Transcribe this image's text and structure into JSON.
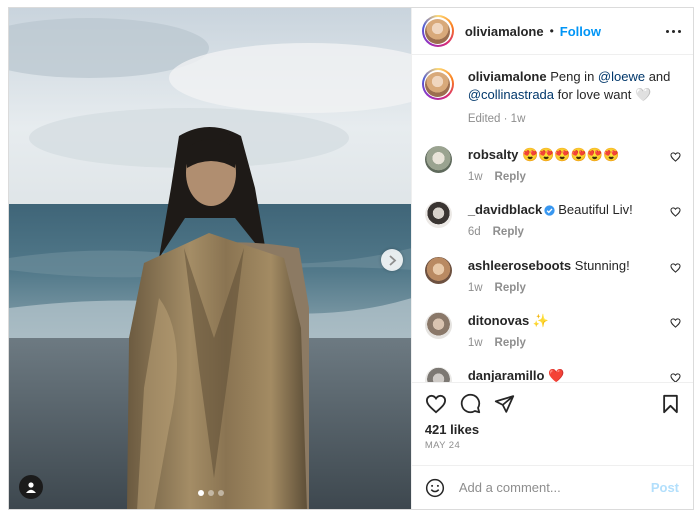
{
  "post": {
    "carousel": {
      "count": 3,
      "active_index": 0
    }
  },
  "header": {
    "username": "oliviamalone",
    "separator": "•",
    "follow_label": "Follow"
  },
  "caption": {
    "username": "oliviamalone",
    "text_before": "Peng in ",
    "mention_1": "@loewe",
    "text_middle": " and ",
    "mention_2": "@collinastrada",
    "text_after": " for love want 🤍",
    "edited": "Edited",
    "time": "1w"
  },
  "comments": [
    {
      "username": "robsalty",
      "text": "😍😍😍😍😍😍",
      "time": "1w",
      "reply_label": "Reply",
      "verified": false
    },
    {
      "username": "_davidblack",
      "text": "Beautiful Liv!",
      "time": "6d",
      "reply_label": "Reply",
      "verified": true
    },
    {
      "username": "ashleeroseboots",
      "text": "Stunning!",
      "time": "1w",
      "reply_label": "Reply",
      "verified": false
    },
    {
      "username": "ditonovas",
      "text": "✨",
      "time": "1w",
      "reply_label": "Reply",
      "verified": false
    },
    {
      "username": "danjaramillo",
      "text": "❤️",
      "time": "",
      "reply_label": "",
      "verified": false
    }
  ],
  "engagement": {
    "likes": "421 likes",
    "date": "MAY 24"
  },
  "composer": {
    "placeholder": "Add a comment...",
    "post_label": "Post"
  },
  "colors": {
    "link": "#0095f6",
    "mention": "#00376b",
    "muted": "#8e8e8e",
    "post_disabled": "#b2dffc"
  },
  "icons": [
    "next-arrow-icon",
    "user-tag-icon",
    "more-options-icon",
    "heart-icon",
    "comment-icon",
    "share-icon",
    "bookmark-icon",
    "emoji-icon",
    "verified-badge-icon"
  ]
}
